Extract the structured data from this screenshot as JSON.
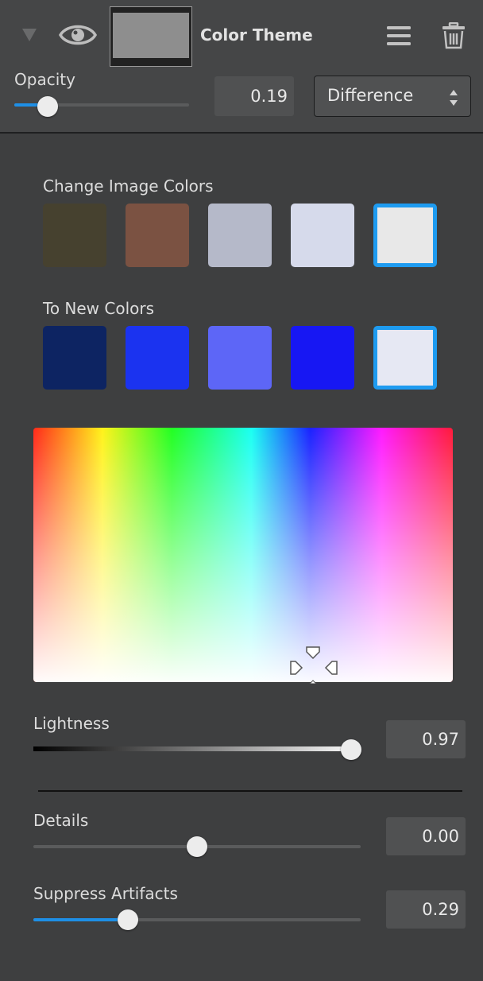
{
  "header": {
    "layer_title": "Color Theme",
    "opacity_label": "Opacity",
    "opacity_value": "0.19",
    "opacity_fraction": 0.19,
    "blend_mode": "Difference"
  },
  "swatches": {
    "source_label": "Change Image Colors",
    "source_colors": [
      "#46412f",
      "#7b5242",
      "#b5b9c9",
      "#d6daeb",
      "#e8e8e8"
    ],
    "target_label": "To New Colors",
    "target_colors": [
      "#0d2462",
      "#1b33f0",
      "#5d66f7",
      "#1717f3",
      "#e6e8f3"
    ],
    "selected_index": 4
  },
  "lightness": {
    "label": "Lightness",
    "value": "0.97",
    "fraction": 0.97
  },
  "details": {
    "label": "Details",
    "value": "0.00",
    "fraction": 0.5
  },
  "suppress": {
    "label": "Suppress Artifacts",
    "value": "0.29",
    "fraction": 0.29
  },
  "colors": {
    "accent": "#1e8fe6",
    "selection": "#1e9bf0"
  },
  "icons": [
    "collapse-triangle-icon",
    "visibility-eye-icon",
    "menu-icon",
    "trash-icon",
    "select-arrows-icon",
    "color-picker-crosshair-icon"
  ]
}
